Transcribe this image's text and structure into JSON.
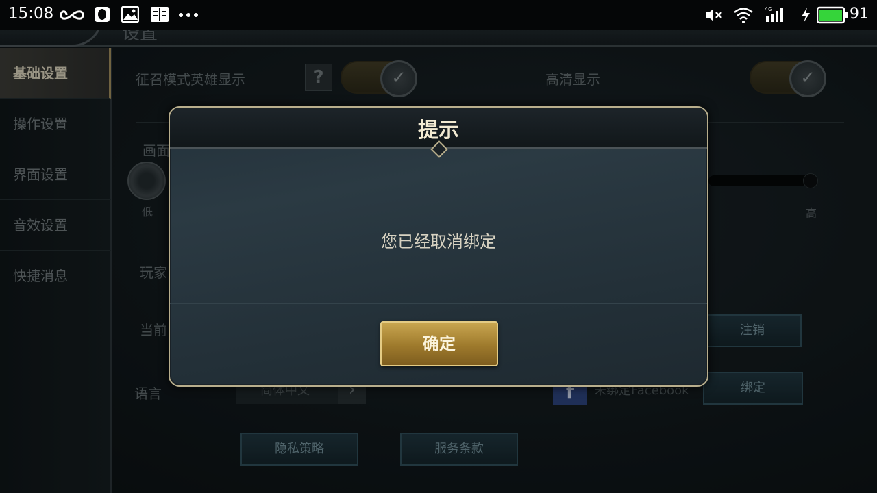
{
  "status_bar": {
    "time": "15:08",
    "battery": "91",
    "icons": [
      "infinity-icon",
      "penguin-icon",
      "image-icon",
      "book-icon",
      "more-dots-icon",
      "mute-icon",
      "wifi-icon",
      "signal-4g-icon",
      "charging-icon",
      "battery-icon"
    ]
  },
  "page": {
    "title": "设置"
  },
  "sidebar": {
    "items": [
      {
        "label": "基础设置",
        "active": true
      },
      {
        "label": "操作设置"
      },
      {
        "label": "界面设置"
      },
      {
        "label": "音效设置"
      },
      {
        "label": "快捷消息"
      }
    ]
  },
  "settings": {
    "recruit_mode_label": "征召模式英雄显示",
    "help_mark": "?",
    "hd_display_label": "高清显示",
    "quality_label": "画面",
    "quality_low": "低",
    "quality_high": "高",
    "player_label": "玩家",
    "current_label": "当前",
    "logout_button": "注销",
    "language_label": "语言",
    "language_value": "简体中文",
    "facebook_status": "未绑定Facebook",
    "bind_button": "绑定",
    "privacy_button": "隐私策略",
    "terms_button": "服务条款"
  },
  "dialog": {
    "title": "提示",
    "message": "您已经取消绑定",
    "confirm_button": "确定"
  },
  "colors": {
    "gold": "#b8ae8c",
    "button_gold": "#c9a650",
    "dialog_bg": "#2b3a43"
  }
}
